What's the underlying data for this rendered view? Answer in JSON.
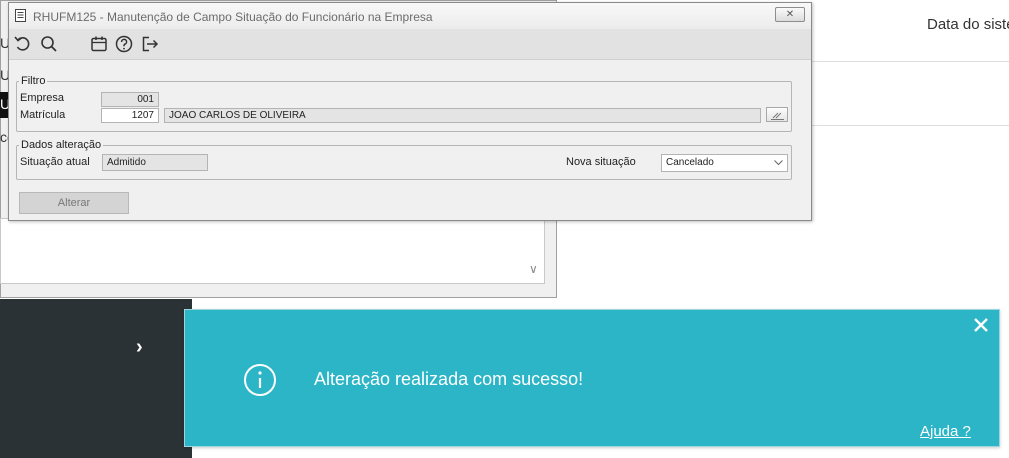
{
  "background": {
    "system_date_label": "Data do siste",
    "left_stubs": [
      "U",
      "U",
      "U",
      "ce"
    ]
  },
  "dialog": {
    "title": "RHUFM125 - Manutenção de Campo Situação do Funcionário na Empresa",
    "close_label": "✕",
    "toolbar_icons": [
      "undo-icon",
      "search-icon",
      "calendar-icon",
      "help-icon",
      "exit-icon"
    ],
    "filter": {
      "legend": "Filtro",
      "empresa_label": "Empresa",
      "empresa_value": "001",
      "matricula_label": "Matrícula",
      "matricula_value": "1207",
      "employee_name": "JOAO CARLOS DE OLIVEIRA"
    },
    "changes": {
      "legend": "Dados alteração",
      "current_status_label": "Situação atual",
      "current_status_value": "Admitido",
      "new_status_label": "Nova situação",
      "new_status_value": "Cancelado"
    },
    "alter_button": "Alterar"
  },
  "toast": {
    "message": "Alteração realizada com sucesso!",
    "help_link": "Ajuda ?",
    "color": "#2bb5c7"
  }
}
